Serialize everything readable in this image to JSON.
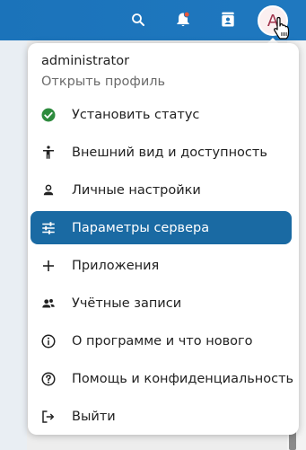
{
  "topbar": {
    "icons": [
      "search-icon",
      "notifications-icon",
      "contacts-icon"
    ],
    "accent": "#1b73ba"
  },
  "avatar": {
    "letter": "A"
  },
  "menu": {
    "user_name": "administrator",
    "profile_link": "Открыть профиль",
    "items": [
      {
        "label": "Установить статус",
        "icon": "status-online-icon"
      },
      {
        "label": "Внешний вид и доступность",
        "icon": "accessibility-icon"
      },
      {
        "label": "Личные настройки",
        "icon": "user-icon"
      },
      {
        "label": "Параметры сервера",
        "icon": "sliders-icon",
        "active": true
      },
      {
        "label": "Приложения",
        "icon": "plus-icon"
      },
      {
        "label": "Учётные записи",
        "icon": "accounts-icon"
      },
      {
        "label": "О программе и что нового",
        "icon": "info-icon"
      },
      {
        "label": "Помощь и конфиденциальность",
        "icon": "help-icon"
      },
      {
        "label": "Выйти",
        "icon": "logout-icon"
      }
    ],
    "active_color": "#1a6aa3",
    "status_color": "#2e8b3e"
  }
}
